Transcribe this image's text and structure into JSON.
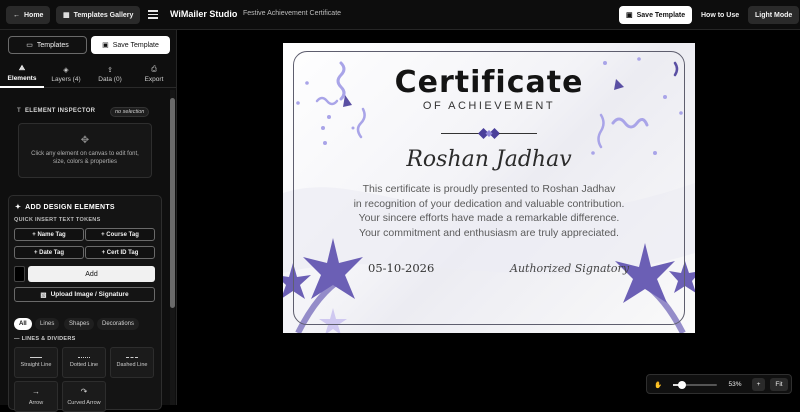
{
  "topbar": {
    "home_label": "Home",
    "gallery_label": "Templates Gallery",
    "brand": "WiMailer Studio",
    "doc_title": "Festive Achievement Certificate",
    "save_label": "Save Template",
    "how_label": "How to Use",
    "light_label": "Light Mode"
  },
  "sidebar": {
    "templates_label": "Templates",
    "save_template_label": "Save Template",
    "tabs": [
      {
        "label": "Elements",
        "icon": "elements-icon"
      },
      {
        "label": "Layers (4)",
        "icon": "layers-icon"
      },
      {
        "label": "Data (0)",
        "icon": "data-icon"
      },
      {
        "label": "Export",
        "icon": "export-icon"
      }
    ],
    "inspector": {
      "title": "ELEMENT INSPECTOR",
      "badge": "no selection",
      "hint": "Click any element on canvas to edit font, size, colors & properties"
    },
    "design": {
      "title": "ADD DESIGN ELEMENTS",
      "tokens_title": "QUICK INSERT TEXT TOKENS",
      "tokens": [
        "+ Name Tag",
        "+ Course Tag",
        "+ Date Tag",
        "+ Cert ID Tag"
      ],
      "add_label": "Add",
      "upload_label": "Upload Image / Signature",
      "chips": [
        "All",
        "Lines",
        "Shapes",
        "Decorations"
      ],
      "lines_title": "— LINES & DIVIDERS",
      "line_items": [
        "Straight Line",
        "Dotted Line",
        "Dashed Line",
        "Arrow",
        "Curved Arrow"
      ]
    }
  },
  "certificate": {
    "title": "Certificate",
    "subtitle": "OF ACHIEVEMENT",
    "recipient": "Roshan Jadhav",
    "body": [
      "This certificate is proudly presented to Roshan Jadhav",
      "in recognition of your dedication and valuable contribution.",
      "Your sincere efforts have made a remarkable difference.",
      "Your commitment and enthusiasm are truly appreciated."
    ],
    "date": "05-10-2026",
    "signature": "Authorized Signatory",
    "colors": {
      "accent": "#5a4fa3",
      "star": "#6b5fb5",
      "confetti": "#a9a4e8"
    }
  },
  "zoom": {
    "value": "53%",
    "plus_label": "+",
    "fit_label": "Fit"
  }
}
